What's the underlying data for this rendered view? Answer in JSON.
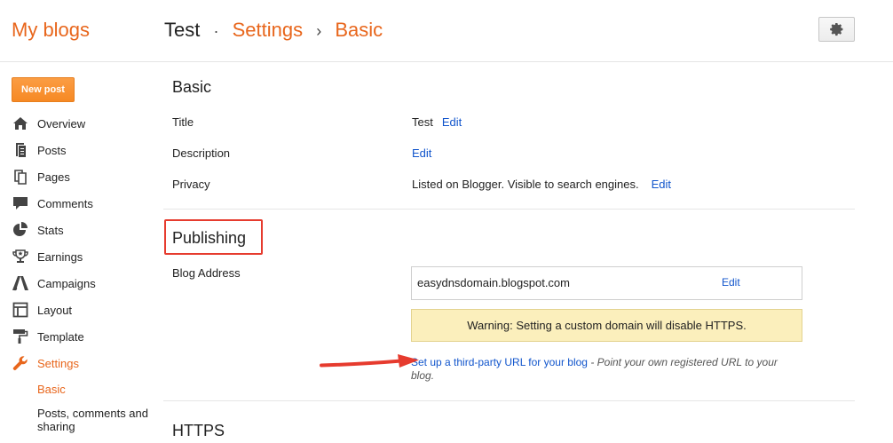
{
  "header": {
    "brand": "My blogs",
    "blog_name": "Test",
    "separator_dot": "·",
    "breadcrumb_1": "Settings",
    "separator_arrow": "›",
    "breadcrumb_2": "Basic",
    "gear_icon": "gear-icon"
  },
  "sidebar": {
    "new_post": "New post",
    "items": [
      {
        "label": "Overview",
        "icon": "home-icon"
      },
      {
        "label": "Posts",
        "icon": "posts-icon"
      },
      {
        "label": "Pages",
        "icon": "pages-icon"
      },
      {
        "label": "Comments",
        "icon": "comment-icon"
      },
      {
        "label": "Stats",
        "icon": "stats-pie-icon"
      },
      {
        "label": "Earnings",
        "icon": "trophy-icon"
      },
      {
        "label": "Campaigns",
        "icon": "campaigns-icon"
      },
      {
        "label": "Layout",
        "icon": "layout-icon"
      },
      {
        "label": "Template",
        "icon": "paint-roller-icon"
      },
      {
        "label": "Settings",
        "icon": "wrench-icon"
      }
    ],
    "sub_items": [
      {
        "label": "Basic"
      },
      {
        "label": "Posts, comments and sharing"
      }
    ],
    "active_color": "#e8661c"
  },
  "main": {
    "basic": {
      "title": "Basic",
      "rows": [
        {
          "label": "Title",
          "value": "Test",
          "edit": "Edit"
        },
        {
          "label": "Description",
          "value": "",
          "edit": "Edit"
        },
        {
          "label": "Privacy",
          "value": "Listed on Blogger. Visible to search engines.",
          "edit": "Edit"
        }
      ]
    },
    "publishing": {
      "title": "Publishing",
      "blog_address_label": "Blog Address",
      "address": "easydnsdomain.blogspot.com",
      "address_edit": "Edit",
      "warning": "Warning: Setting a custom domain will disable HTTPS.",
      "third_party_link": "Set up a third-party URL for your blog",
      "third_party_desc": " - Point your own registered URL to your blog."
    },
    "https": {
      "title": "HTTPS"
    }
  },
  "colors": {
    "link": "#1155cc",
    "orange": "#e8661c",
    "annotation_red": "#e63b2e",
    "warning_bg": "#fbefbc"
  }
}
